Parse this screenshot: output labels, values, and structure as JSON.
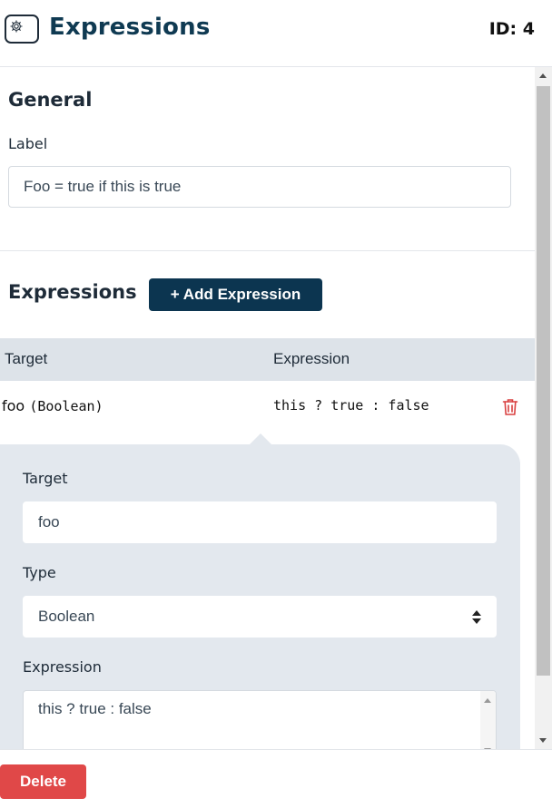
{
  "header": {
    "title": "Expressions",
    "id_text": "ID: 4",
    "icon": "gear-icon"
  },
  "general": {
    "title": "General",
    "label_caption": "Label",
    "label_value": "Foo = true if this is true"
  },
  "expressions": {
    "title": "Expressions",
    "add_button": "+ Add Expression",
    "columns": [
      "Target",
      "Expression"
    ],
    "rows": [
      {
        "target": "foo",
        "type_suffix": "(Boolean)",
        "expression": "this ? true : false",
        "delete_icon": "trash-icon"
      }
    ]
  },
  "detail": {
    "target_label": "Target",
    "target_value": "foo",
    "type_label": "Type",
    "type_value": "Boolean",
    "expression_label": "Expression",
    "expression_value": "this ? true : false"
  },
  "footer": {
    "delete_button": "Delete"
  },
  "colors": {
    "primary": "#0c3550",
    "danger": "#e04848",
    "panel": "#e3e8ee",
    "table_header": "#dde3e9"
  }
}
